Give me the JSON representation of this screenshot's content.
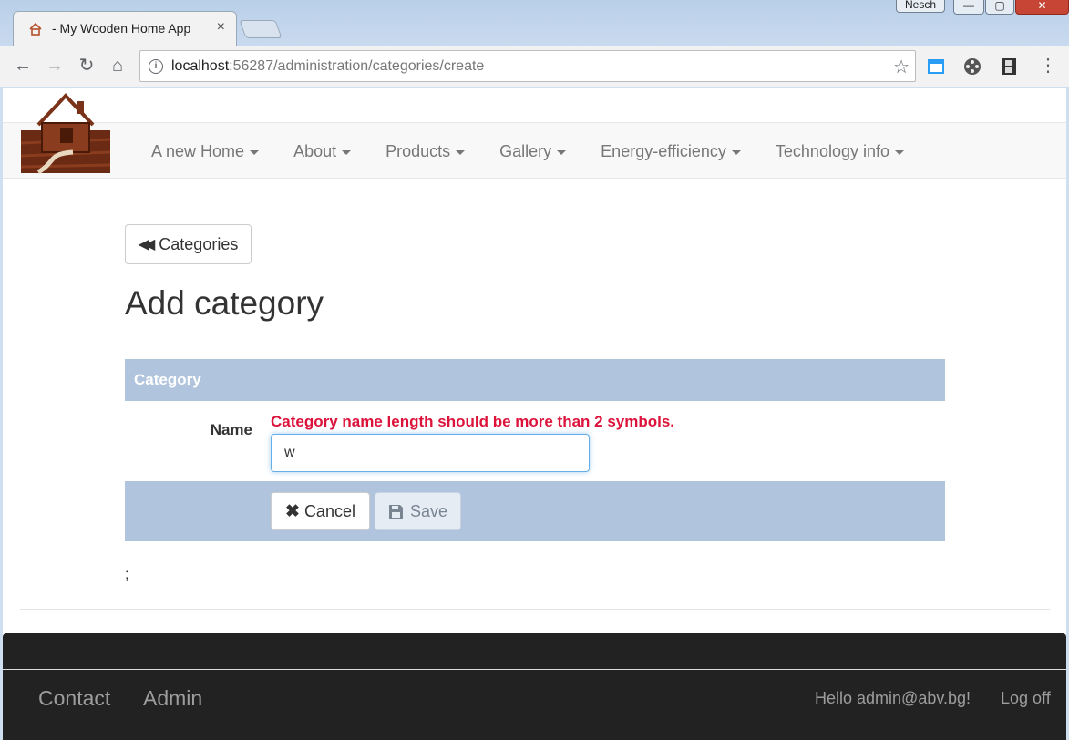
{
  "browser": {
    "tab_title": "- My Wooden Home App",
    "tab_close": "×",
    "user_badge": "Nesch",
    "address": {
      "host": "localhost",
      "port_path": ":56287/administration/categories/create"
    }
  },
  "nav": {
    "items": [
      {
        "label": "A new Home"
      },
      {
        "label": "About"
      },
      {
        "label": "Products"
      },
      {
        "label": "Gallery"
      },
      {
        "label": "Energy-efficiency"
      },
      {
        "label": "Technology info"
      }
    ]
  },
  "content": {
    "back_button": "Categories",
    "title": "Add category",
    "panel_heading": "Category",
    "name_label": "Name",
    "error": "Category name length should be more than 2 symbols.",
    "name_value": "w",
    "cancel_label": "Cancel",
    "save_label": "Save",
    "stray_text": ";"
  },
  "footer": {
    "contact": "Contact",
    "admin": "Admin",
    "greeting": "Hello admin@abv.bg!",
    "logoff": "Log off"
  },
  "colors": {
    "panel": "#b0c4de",
    "error": "#dc143c",
    "footer": "#222222"
  }
}
